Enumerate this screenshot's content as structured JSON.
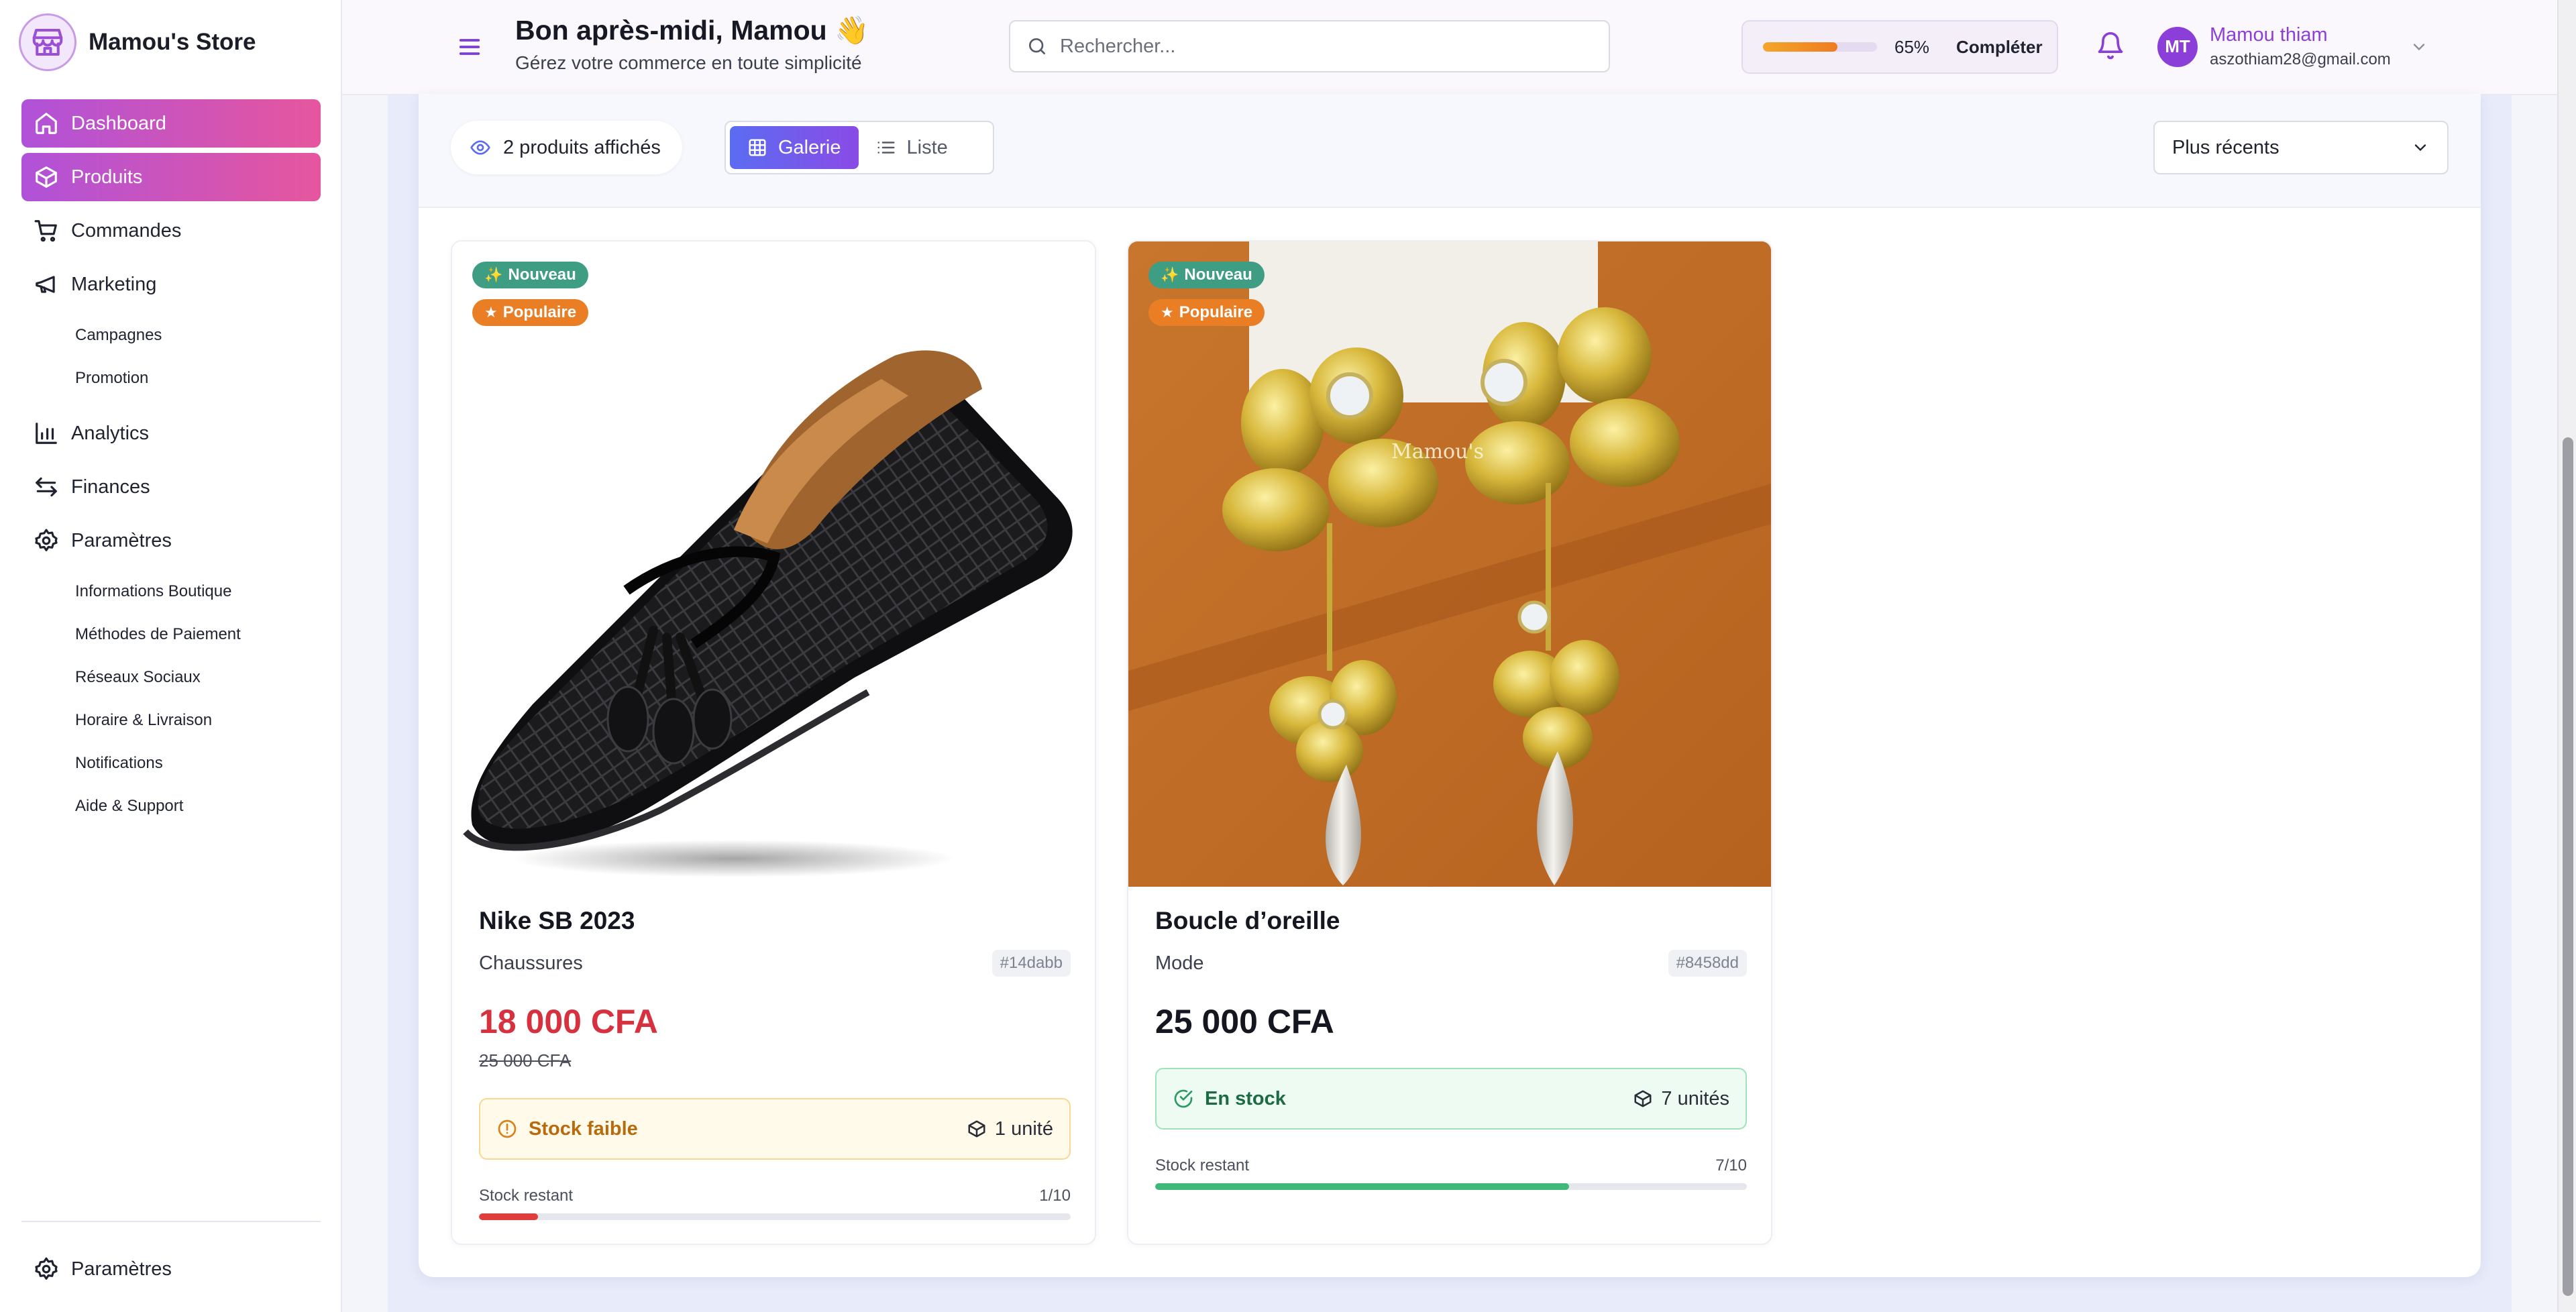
{
  "app": {
    "store_name": "Mamou's Store"
  },
  "sidebar": {
    "items": [
      {
        "label": "Dashboard",
        "icon": "home-icon",
        "active": true
      },
      {
        "label": "Produits",
        "icon": "box-icon",
        "active": true
      },
      {
        "label": "Commandes",
        "icon": "cart-icon"
      },
      {
        "label": "Marketing",
        "icon": "megaphone-icon"
      },
      {
        "label": "Analytics",
        "icon": "bar-chart-icon"
      },
      {
        "label": "Finances",
        "icon": "transfer-icon"
      },
      {
        "label": "Paramètres",
        "icon": "gear-icon"
      }
    ],
    "marketing_sub": [
      "Campagnes",
      "Promotion"
    ],
    "settings_sub": [
      "Informations Boutique",
      "Méthodes de Paiement",
      "Réseaux Sociaux",
      "Horaire & Livraison",
      "Notifications",
      "Aide & Support"
    ],
    "bottom_label": "Paramètres"
  },
  "header": {
    "greeting": "Bon après-midi, Mamou 👋",
    "subtitle": "Gérez votre commerce en toute simplicité",
    "search_placeholder": "Rechercher...",
    "completion_percent": 65,
    "completion_label": "65%",
    "complete_button": "Compléter",
    "user_initials": "MT",
    "user_name": "Mamou thiam",
    "user_email": "aszothiam28@gmail.com"
  },
  "toolbar": {
    "count_label": "2 produits affichés",
    "view_gallery": "Galerie",
    "view_list": "Liste",
    "sort_value": "Plus récents"
  },
  "products": [
    {
      "badge_new": "Nouveau",
      "badge_popular": "Populaire",
      "name": "Nike SB 2023",
      "category": "Chaussures",
      "ref": "#14dabb",
      "price": "18 000 CFA",
      "old_price": "25 000 CFA",
      "stock_status": "Stock faible",
      "stock_units": "1 unité",
      "stock_label": "Stock restant",
      "stock_ratio": "1/10",
      "stock_fraction": 0.1
    },
    {
      "badge_new": "Nouveau",
      "badge_popular": "Populaire",
      "name": "Boucle d’oreille",
      "category": "Mode",
      "ref": "#8458dd",
      "price": "25 000 CFA",
      "stock_status": "En stock",
      "stock_units": "7 unités",
      "stock_label": "Stock restant",
      "stock_ratio": "7/10",
      "stock_fraction": 0.7,
      "image_watermark": "Mamou's"
    }
  ],
  "colors": {
    "accent_purple": "#8b3fd8",
    "price_sale": "#d7313f",
    "stock_low_bar": "#e23c3c",
    "stock_ok_bar": "#3eb97a"
  }
}
